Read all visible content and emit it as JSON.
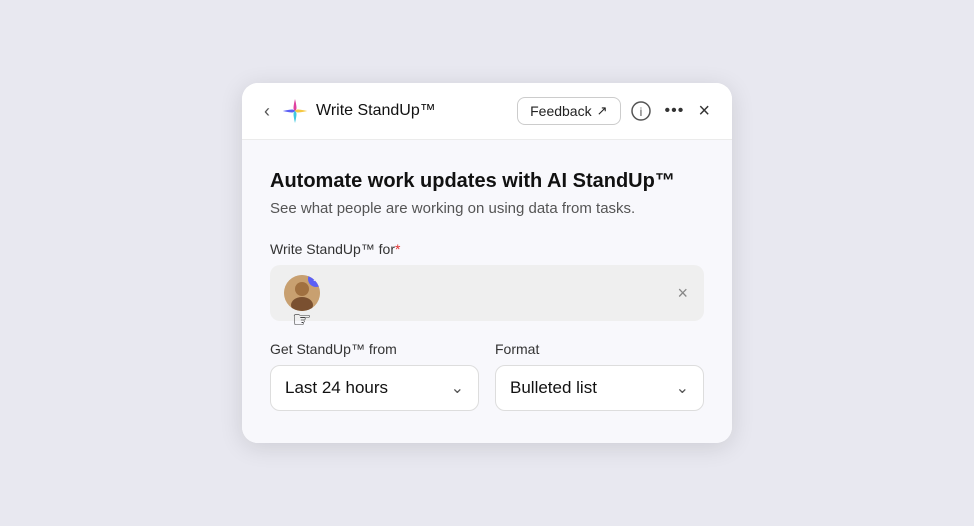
{
  "header": {
    "title": "Write StandUp™",
    "feedback_label": "Feedback",
    "back_label": "‹",
    "close_label": "×",
    "more_label": "···",
    "info_label": "ⓘ",
    "external_link": "↗"
  },
  "body": {
    "main_title": "Automate work updates with AI StandUp™",
    "subtitle": "See what people are working on using data from tasks.",
    "for_label": "Write StandUp™ for",
    "required_marker": "*",
    "clear_label": "×",
    "from_label": "Get StandUp™ from",
    "from_value": "Last 24 hours",
    "format_label": "Format",
    "format_value": "Bulleted list"
  }
}
